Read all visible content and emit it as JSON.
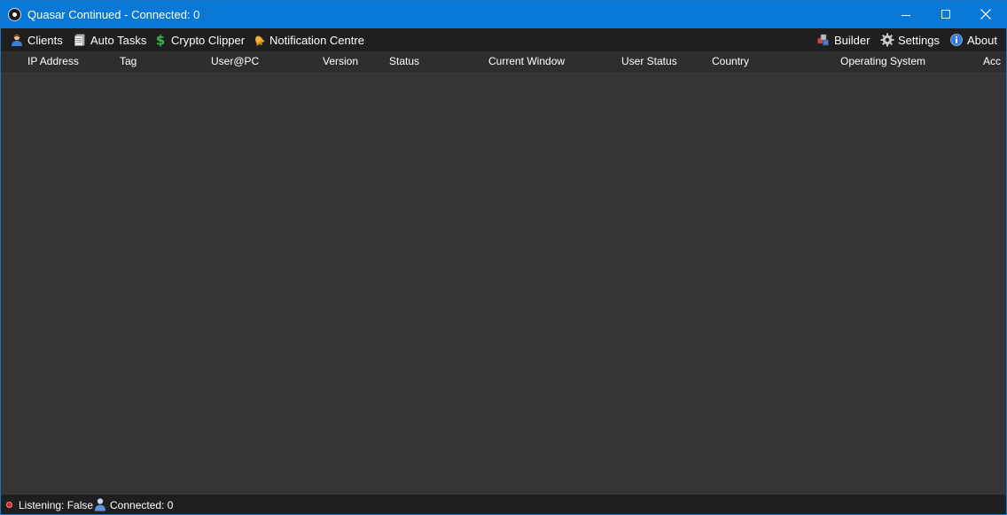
{
  "window": {
    "title": "Quasar Continued - Connected: 0"
  },
  "menu": {
    "left": [
      {
        "label": "Clients",
        "icon": "user-icon"
      },
      {
        "label": "Auto Tasks",
        "icon": "document-icon"
      },
      {
        "label": "Crypto Clipper",
        "icon": "dollar-icon"
      },
      {
        "label": "Notification Centre",
        "icon": "bell-icon"
      }
    ],
    "right": [
      {
        "label": "Builder",
        "icon": "builder-icon"
      },
      {
        "label": "Settings",
        "icon": "gear-icon"
      },
      {
        "label": "About",
        "icon": "info-icon"
      }
    ]
  },
  "table": {
    "columns": [
      "IP Address",
      "Tag",
      "User@PC",
      "Version",
      "Status",
      "Current Window",
      "User Status",
      "Country",
      "Operating System",
      "Acc"
    ],
    "rows": []
  },
  "statusbar": {
    "listening": "Listening: False",
    "connected": "Connected: 0"
  },
  "colors": {
    "titlebar": "#0a78d7",
    "menubar": "#1f1f1f",
    "body": "#353535",
    "listening_indicator": "#e02020"
  }
}
